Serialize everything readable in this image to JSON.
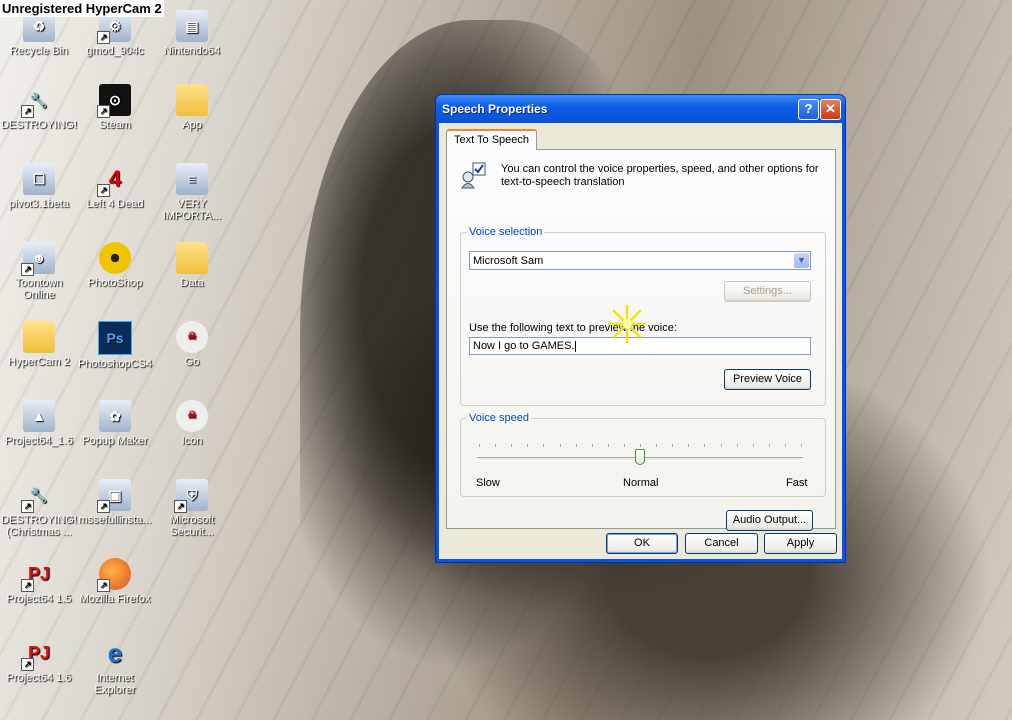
{
  "recorder": {
    "watermark": "Unregistered HyperCam 2"
  },
  "desktop": {
    "icons": [
      {
        "label": "Recycle Bin"
      },
      {
        "label": "gmod_904c"
      },
      {
        "label": "Nintendo64"
      },
      {
        "label": "DESTROYING!"
      },
      {
        "label": "Steam"
      },
      {
        "label": "App"
      },
      {
        "label": "pivot3.1beta"
      },
      {
        "label": "Left 4 Dead"
      },
      {
        "label": "VERY IMPORTA..."
      },
      {
        "label": "Toontown Online"
      },
      {
        "label": "PhotoShop"
      },
      {
        "label": "Data"
      },
      {
        "label": "HyperCam 2"
      },
      {
        "label": "PhotoshopCS4"
      },
      {
        "label": "Go"
      },
      {
        "label": "Project64_1.6"
      },
      {
        "label": "Popup Maker"
      },
      {
        "label": "Icon"
      },
      {
        "label": "DESTROYING! (Christmas ..."
      },
      {
        "label": "mssefullinsta..."
      },
      {
        "label": "Microsoft Securit..."
      },
      {
        "label": "Project64 1.5"
      },
      {
        "label": "Mozilla Firefox"
      },
      {
        "label": "Project64 1.6"
      },
      {
        "label": "Internet Explorer"
      }
    ]
  },
  "dialog": {
    "title": "Speech Properties",
    "help_glyph": "?",
    "close_glyph": "✕",
    "tab_label": "Text To Speech",
    "intro_text": "You can control the voice properties, speed, and other options for text-to-speech translation",
    "voice_selection": {
      "group_label": "Voice selection",
      "selected_voice": "Microsoft Sam",
      "settings_label": "Settings..."
    },
    "preview": {
      "label": "Use the following text to preview the voice:",
      "text": "Now I go to GAMES.",
      "button_label": "Preview Voice"
    },
    "voice_speed": {
      "group_label": "Voice speed",
      "slow_label": "Slow",
      "normal_label": "Normal",
      "fast_label": "Fast",
      "value_fraction": 0.5
    },
    "audio_output_label": "Audio Output...",
    "ok_label": "OK",
    "cancel_label": "Cancel",
    "apply_label": "Apply"
  },
  "colors": {
    "title_bar": "#0a54e3",
    "dialog_face": "#ece9d8",
    "group_label": "#0046d5"
  }
}
